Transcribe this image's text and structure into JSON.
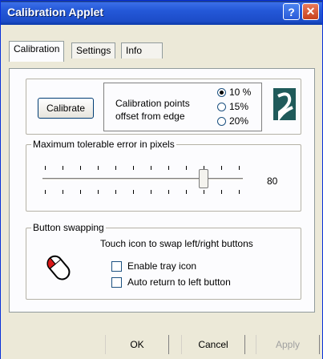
{
  "window": {
    "title": "Calibration Applet",
    "help_glyph": "?",
    "close_glyph": "✕"
  },
  "tabs": [
    {
      "label": "Calibration"
    },
    {
      "label": "Settings"
    },
    {
      "label": "Info"
    }
  ],
  "calibration": {
    "button_label": "Calibrate",
    "points_label_line1": "Calibration points",
    "points_label_line2": "offset from edge",
    "options": [
      {
        "label": "10 %",
        "selected": true
      },
      {
        "label": "15%",
        "selected": false
      },
      {
        "label": "20%",
        "selected": false
      }
    ]
  },
  "error_group": {
    "title": "Maximum tolerable error in pixels",
    "value": "80",
    "slider_level": 80
  },
  "swap_group": {
    "title": "Button swapping",
    "instruction": "Touch icon to swap left/right buttons",
    "checkboxes": [
      {
        "label": "Enable tray icon",
        "checked": false
      },
      {
        "label": "Auto return to left button",
        "checked": false
      }
    ]
  },
  "buttons": {
    "ok": "OK",
    "cancel": "Cancel",
    "apply": "Apply"
  },
  "colors": {
    "title_bar": "#2458d8",
    "close_button": "#d0502a",
    "face": "#ece9d8",
    "logo": "#1f5a5a"
  },
  "icons": {
    "logo": "stylized-s-icon",
    "mouse": "mouse-icon"
  }
}
